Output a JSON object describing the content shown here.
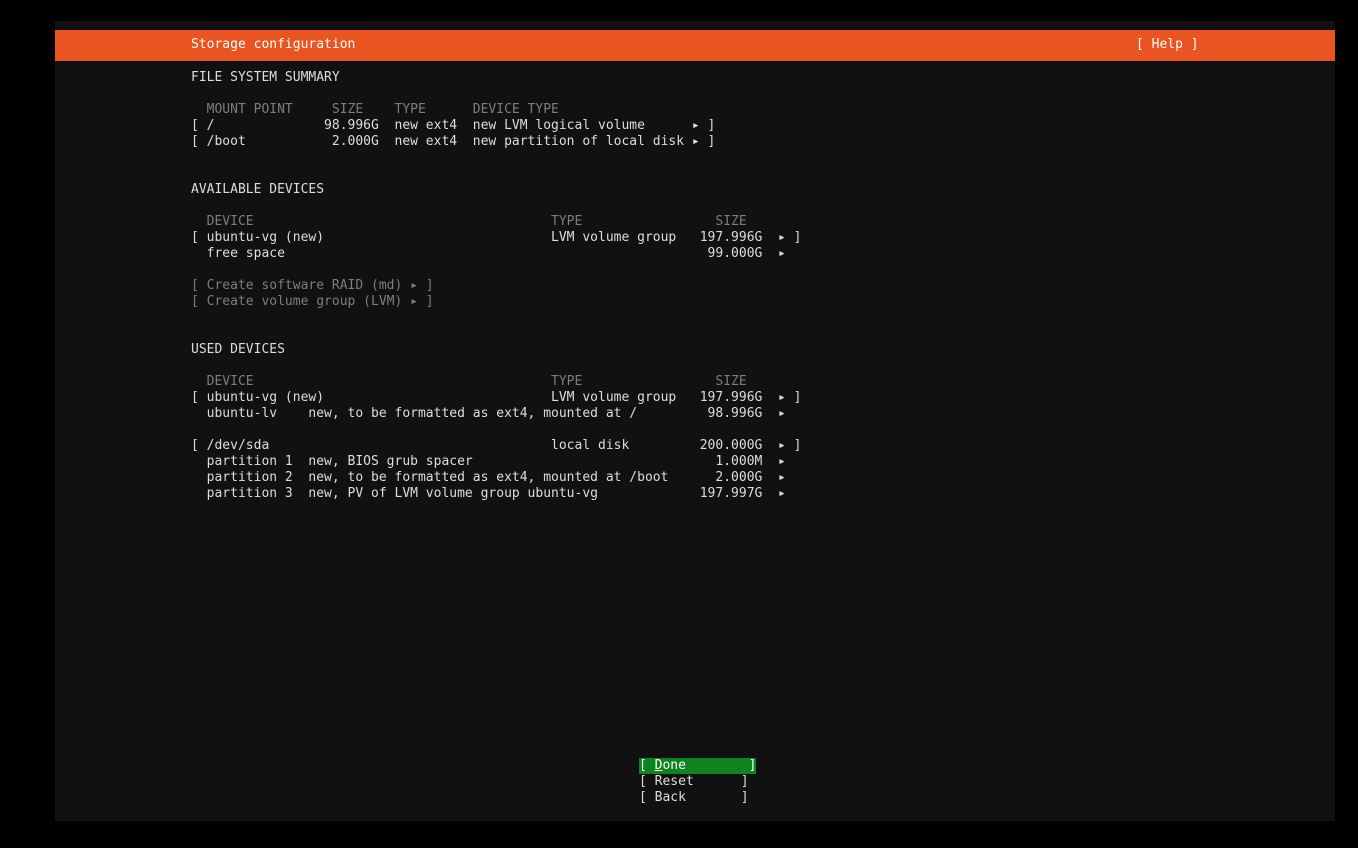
{
  "header": {
    "title": "Storage configuration",
    "help": "[ Help ]"
  },
  "fs_summary": {
    "heading": "FILE SYSTEM SUMMARY",
    "columns": "  MOUNT POINT     SIZE    TYPE      DEVICE TYPE",
    "rows": [
      "[ /              98.996G  new ext4  new LVM logical volume      ▸ ]",
      "[ /boot           2.000G  new ext4  new partition of local disk ▸ ]"
    ]
  },
  "available": {
    "heading": "AVAILABLE DEVICES",
    "columns": "  DEVICE                                      TYPE                 SIZE",
    "rows": [
      "[ ubuntu-vg (new)                             LVM volume group   197.996G  ▸ ]",
      "  free space                                                      99.000G  ▸"
    ],
    "actions": [
      "[ Create software RAID (md) ▸ ]",
      "[ Create volume group (LVM) ▸ ]"
    ]
  },
  "used": {
    "heading": "USED DEVICES",
    "columns": "  DEVICE                                      TYPE                 SIZE",
    "rows": [
      "[ ubuntu-vg (new)                             LVM volume group   197.996G  ▸ ]",
      "  ubuntu-lv    new, to be formatted as ext4, mounted at /         98.996G  ▸",
      "[ /dev/sda                                    local disk         200.000G  ▸ ]",
      "  partition 1  new, BIOS grub spacer                               1.000M  ▸",
      "  partition 2  new, to be formatted as ext4, mounted at /boot      2.000G  ▸",
      "  partition 3  new, PV of LVM volume group ubuntu-vg             197.997G  ▸"
    ]
  },
  "buttons": {
    "done": {
      "open": "[ ",
      "hotkey": "D",
      "rest": "one        ]"
    },
    "reset": "[ Reset      ]",
    "back": "[ Back       ]"
  },
  "colors": {
    "title_bar": "#E95420",
    "focused_button": "#0E8420",
    "background": "#111111"
  }
}
